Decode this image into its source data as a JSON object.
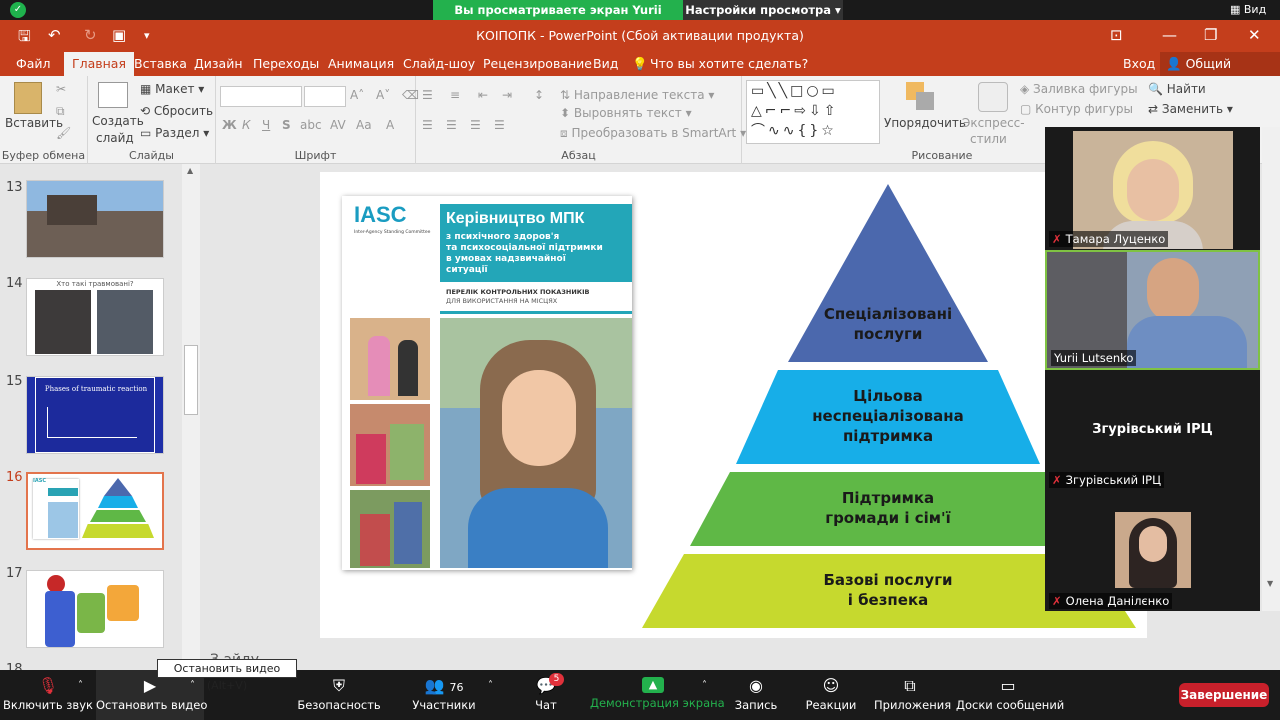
{
  "zoom_top": {
    "banner": "Вы просматриваете экран Yurii Lutsenko",
    "view_options": "Настройки просмотра",
    "view_btn": "Вид"
  },
  "app": {
    "title": "КОІПОПК - PowerPoint (Сбой активации продукта)"
  },
  "menu": {
    "tabs": [
      "Файл",
      "Главная",
      "Вставка",
      "Дизайн",
      "Переходы",
      "Анимация",
      "Слайд-шоу",
      "Рецензирование",
      "Вид"
    ],
    "tell_me": "Что вы хотите сделать?",
    "sign_in": "Вход",
    "share": "Общий доступ"
  },
  "ribbon": {
    "clipboard": {
      "paste": "Вставить",
      "group": "Буфер обмена"
    },
    "slides": {
      "create": "Создать",
      "create2": "слайд",
      "layout": "Макет",
      "reset": "Сбросить",
      "section": "Раздел",
      "group": "Слайды"
    },
    "font": {
      "group": "Шрифт",
      "bold": "Ж",
      "italic": "К",
      "underline": "Ч",
      "strike": "S"
    },
    "paragraph": {
      "direction": "Направление текста",
      "align": "Выровнять текст",
      "smartart": "Преобразовать в SmartArt",
      "group": "Абзац"
    },
    "drawing": {
      "arrange": "Упорядочить",
      "quick_styles": "Экспресс-",
      "quick_styles2": "стили",
      "fill": "Заливка фигуры",
      "outline": "Контур фигуры",
      "group": "Рисование"
    },
    "editing": {
      "find": "Найти",
      "replace": "Заменить"
    }
  },
  "slides_panel": {
    "numbers": [
      "13",
      "14",
      "15",
      "16",
      "17",
      "18"
    ],
    "thumb14_title": "Хто такі травмовані?",
    "thumb15_title": "Phases of traumatic reaction",
    "thumb16_header": "IASC"
  },
  "slide": {
    "booklet": {
      "logo": "IASC",
      "org": "Inter-Agency Standing Committee",
      "title": "Керівництво МПК",
      "subtitle1": "з психічного здоров'я",
      "subtitle2": "та психосоціальної підтримки",
      "subtitle3": "в умовах надзвичайної",
      "subtitle4": "ситуації",
      "checklist1": "ПЕРЕЛІК КОНТРОЛЬНИХ ПОКАЗНИКІВ",
      "checklist2": "ДЛЯ ВИКОРИСТАННЯ НА МІСЦЯХ"
    },
    "pyramid": {
      "level1_a": "Спеціалізовані",
      "level1_b": "послуги",
      "level2_a": "Цільова",
      "level2_b": "неспеціалізована",
      "level2_c": "підтримка",
      "level3_a": "Підтримка",
      "level3_b": "громади і сім'ї",
      "level4_a": "Базові послуги",
      "level4_b": "і безпека",
      "colors": [
        "#4b68ad",
        "#17aee8",
        "#5fb846",
        "#c6d92e"
      ]
    }
  },
  "notes_text": "З     айду",
  "participants": [
    {
      "name": "Тамара Луценко",
      "muted": true
    },
    {
      "name": "Yurii Lutsenko",
      "muted": false
    },
    {
      "name": "Згурівський ІРЦ",
      "muted": true,
      "label": "Згурівський ІРЦ"
    },
    {
      "name": "Олена Данілєнко",
      "muted": true
    }
  ],
  "toolbar": {
    "mute": "Включить звук",
    "stop_video": "Остановить видео",
    "security": "Безопасность",
    "participants": "Участники",
    "participants_count": "76",
    "chat": "Чат",
    "chat_badge": "5",
    "share": "Демонстрация экрана",
    "record": "Запись",
    "reactions": "Реакции",
    "apps": "Приложения",
    "whiteboard": "Доски сообщений",
    "end": "Завершение"
  },
  "tooltip": "Остановить видео (Alt+V)"
}
